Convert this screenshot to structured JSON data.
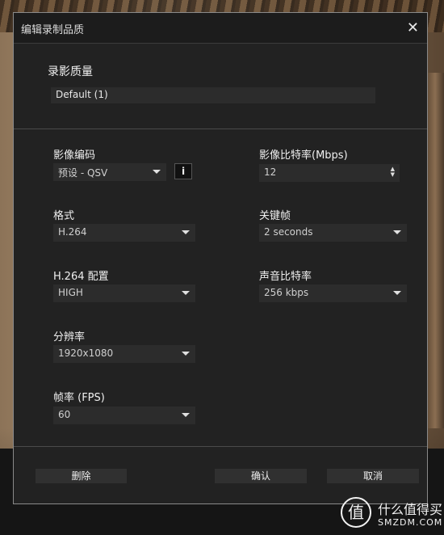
{
  "dialog": {
    "title": "编辑录制品质",
    "close_glyph": "✕"
  },
  "quality": {
    "section_title": "录影质量",
    "preset_value": "Default (1)"
  },
  "fields": {
    "video_encoder": {
      "label": "影像编码",
      "value": "预设 - QSV",
      "info_glyph": "i"
    },
    "video_bitrate": {
      "label": "影像比特率(Mbps)",
      "value": "12"
    },
    "format": {
      "label": "格式",
      "value": "H.264"
    },
    "keyframe": {
      "label": "关键帧",
      "value": "2 seconds"
    },
    "profile": {
      "label": "H.264 配置",
      "value": "HIGH"
    },
    "audio_bitrate": {
      "label": "声音比特率",
      "value": "256 kbps"
    },
    "resolution": {
      "label": "分辨率",
      "value": "1920x1080"
    },
    "framerate": {
      "label": "帧率 (FPS)",
      "value": "60"
    }
  },
  "buttons": {
    "delete": "删除",
    "confirm": "确认",
    "cancel": "取消"
  },
  "watermark": {
    "glyph": "值",
    "text": "什么值得买",
    "domain": "SMZDM.COM"
  },
  "colors": {
    "dialog_bg": "#222222",
    "field_bg": "#2c2c2c",
    "border": "#8a8a8a"
  }
}
